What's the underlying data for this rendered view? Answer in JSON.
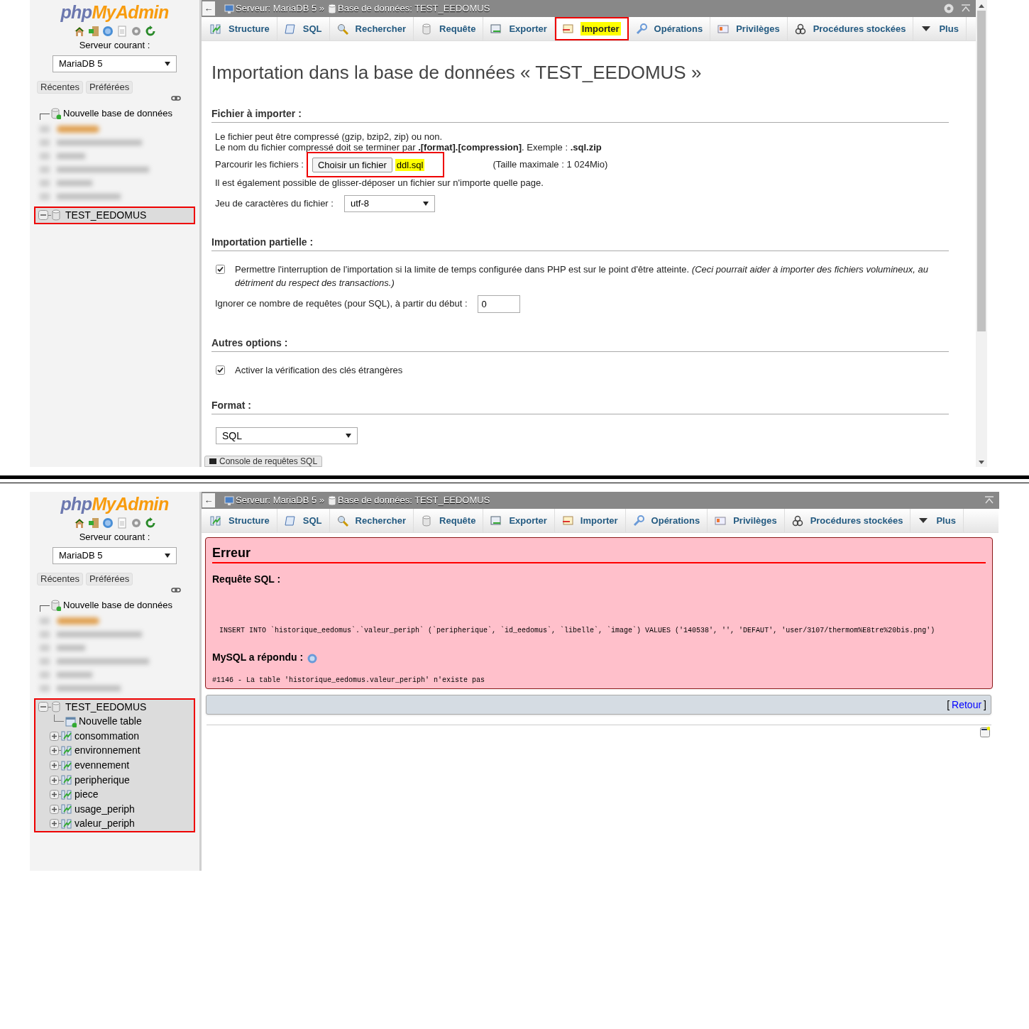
{
  "import_screen": {
    "sidebar": {
      "logo": {
        "part_1": "php",
        "part_2": "MyAdmin"
      },
      "server_label": "Serveur courant :",
      "server_value": "MariaDB 5",
      "buttons": [
        "Récentes",
        "Préférées"
      ],
      "new_db": "Nouvelle base de données",
      "databases": [
        {
          "name": "TEST_EEDOMUS",
          "selected": true,
          "expanded": true,
          "highlighted": true
        }
      ]
    },
    "breadcrumb": {
      "back": "←",
      "server": "Serveur: MariaDB 5 »",
      "database": "Base de données: TEST_EEDOMUS"
    },
    "tabs": [
      {
        "label": "Structure",
        "selected": false,
        "highlighted": false
      },
      {
        "label": "SQL",
        "selected": false,
        "highlighted": false
      },
      {
        "label": "Rechercher",
        "selected": false,
        "highlighted": false
      },
      {
        "label": "Requête",
        "selected": false,
        "highlighted": false
      },
      {
        "label": "Exporter",
        "selected": false,
        "highlighted": false
      },
      {
        "label": "Importer",
        "selected": true,
        "highlighted": true
      },
      {
        "label": "Opérations",
        "selected": false,
        "highlighted": false
      },
      {
        "label": "Privilèges",
        "selected": false,
        "highlighted": false
      },
      {
        "label": "Procédures stockées",
        "selected": false,
        "highlighted": false
      },
      {
        "label": "Plus",
        "selected": false,
        "highlighted": false
      }
    ],
    "title": "Importation dans la base de données « TEST_EEDOMUS »",
    "file_section": {
      "legend": "Fichier à importer :",
      "notes": [
        "Le fichier peut être compressé (gzip, bzip2, zip) ou non.",
        "Le nom du fichier compressé doit se terminer par **.[format].[compression]**. Exemple : **.sql.zip**"
      ],
      "browse_label": "Parcourir les fichiers :",
      "choose_button": "Choisir un fichier",
      "file_name": "ddl.sql",
      "highlighted": true,
      "max_size": "(Taille maximale : 1 024Mio)",
      "drag_note": "Il est également possible de glisser-déposer un fichier sur n'importe quelle page.",
      "charset_label": "Jeu de caractères du fichier :",
      "charset_value": "utf-8"
    },
    "partial_section": {
      "legend": "Importation partielle :",
      "interrupt": {
        "checked": true,
        "label": "Permettre l'interruption de l'importation si la limite de temps configurée dans PHP est sur le point d'être atteinte. *(Ceci pourrait aider à importer des fichiers volumineux, au détriment du respect des transactions.)*"
      },
      "skip_label": "Ignorer ce nombre de requêtes (pour SQL), à partir du début :",
      "skip_value": "0"
    },
    "other_section": {
      "legend": "Autres options :",
      "foreign_keys": {
        "checked": true,
        "label": "Activer la vérification des clés étrangères"
      }
    },
    "format_section": {
      "legend": "Format :",
      "value": "SQL"
    },
    "console_tab": "Console de requêtes SQL"
  },
  "error_screen": {
    "sidebar": {
      "logo": {
        "part_1": "php",
        "part_2": "MyAdmin"
      },
      "server_label": "Serveur courant :",
      "server_value": "MariaDB 5",
      "buttons": [
        "Récentes",
        "Préférées"
      ],
      "new_db": "Nouvelle base de données",
      "databases": [
        {
          "name": "TEST_EEDOMUS",
          "selected": true,
          "expanded": true,
          "highlighted": true,
          "children": [
            {
              "kind": "new",
              "name": "Nouvelle table"
            },
            {
              "kind": "table",
              "name": "consommation"
            },
            {
              "kind": "table",
              "name": "environnement"
            },
            {
              "kind": "table",
              "name": "evennement"
            },
            {
              "kind": "table",
              "name": "peripherique"
            },
            {
              "kind": "table",
              "name": "piece"
            },
            {
              "kind": "table",
              "name": "usage_periph"
            },
            {
              "kind": "table",
              "name": "valeur_periph"
            }
          ]
        }
      ]
    },
    "breadcrumb": {
      "back": "←",
      "server": "Serveur: MariaDB 5 »",
      "database": "Base de données: TEST_EEDOMUS"
    },
    "tabs": [
      {
        "label": "Structure",
        "selected": false,
        "highlighted": false
      },
      {
        "label": "SQL",
        "selected": false,
        "highlighted": false
      },
      {
        "label": "Rechercher",
        "selected": false,
        "highlighted": false
      },
      {
        "label": "Requête",
        "selected": false,
        "highlighted": false
      },
      {
        "label": "Exporter",
        "selected": false,
        "highlighted": false
      },
      {
        "label": "Importer",
        "selected": false,
        "highlighted": false
      },
      {
        "label": "Opérations",
        "selected": false,
        "highlighted": false
      },
      {
        "label": "Privilèges",
        "selected": false,
        "highlighted": false
      },
      {
        "label": "Procédures stockées",
        "selected": false,
        "highlighted": false
      },
      {
        "label": "Plus",
        "selected": false,
        "highlighted": false
      }
    ],
    "error": {
      "title": "Erreur",
      "query_label": "Requête SQL :",
      "query": "INSERT INTO `historique_eedomus`.`valeur_periph` (`peripherique`, `id_eedomus`, `libelle`, `image`) VALUES ('140538', '', 'DEFAUT', 'user/3107/thermom%E8tre%20bis.png')",
      "response_label": "MySQL a répondu :",
      "message": "#1146 - La table 'historique_eedomus.valeur_periph' n'existe pas"
    },
    "back": {
      "open": "[",
      "label": "Retour",
      "close": "]"
    }
  }
}
